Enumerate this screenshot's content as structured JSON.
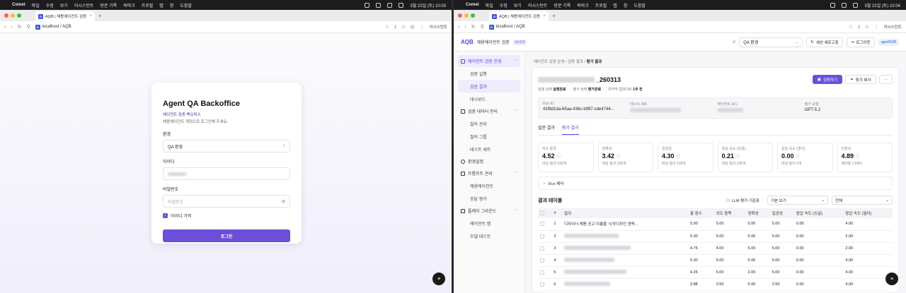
{
  "left": {
    "menubar": {
      "app": "Comet",
      "items": [
        "파일",
        "수정",
        "보기",
        "어시스턴트",
        "방문 기록",
        "북마크",
        "프로필",
        "탭",
        "창",
        "도움말"
      ],
      "clock": "3월 22일 (토) 10:03"
    },
    "tab": {
      "title": "AQB | 채용에이전트 검증"
    },
    "address": {
      "url": "localhost / AQB",
      "assistant": "어시스턴트"
    },
    "login": {
      "title": "Agent QA Backoffice",
      "subtitle": "에이전트 검증 백오피스",
      "hint": "채용에이전트 계정으로 로그인해 주세요.",
      "env_label": "환경",
      "env_value": "QA 환경",
      "id_label": "아이디",
      "pw_label": "비밀번호",
      "pw_placeholder": "비밀번호",
      "remember": "아이디 기억",
      "submit": "로그인"
    }
  },
  "right": {
    "menubar": {
      "app": "Comet",
      "items": [
        "파일",
        "수정",
        "보기",
        "어시스턴트",
        "방문 기록",
        "북마크",
        "프로필",
        "탭",
        "창",
        "도움말"
      ],
      "clock": "3월 22일 (토) 10:04"
    },
    "tab": {
      "title": "AQB | 채용에이전트 검증"
    },
    "address": {
      "url": "localhost / AQB",
      "assistant": "어시스턴트"
    },
    "header": {
      "logo": "AQB",
      "app_name": "채용에이전트 검증",
      "version": "v1.0.0",
      "env": "QA 환경",
      "refresh": "세션 새로고침",
      "logout": "로그아웃",
      "user": "ago0528"
    },
    "sidebar": {
      "groups": [
        {
          "label": "에이전트 검증 운영",
          "items": [
            "검증 실행",
            "검증 결과",
            "대시보드"
          ]
        },
        {
          "label": "검증 데이터 관리",
          "items": [
            "질의 관리",
            "질의 그룹",
            "테스트 세트"
          ]
        },
        {
          "label": "환경설정",
          "items": []
        },
        {
          "label": "프롬프트 관리",
          "items": [
            "채용에이전트",
            "응답 평가"
          ]
        },
        {
          "label": "플레이 그라운드",
          "items": [
            "에이전트 맵",
            "모델 테스트"
          ]
        }
      ]
    },
    "breadcrumb": [
      "에이전트 검증 운영",
      "검증 결과",
      "평가 결과"
    ],
    "run": {
      "title_suffix": "_260313",
      "run_button": "검증하기",
      "copy_link": "링크 복사",
      "more": "···",
      "exec_status_label": "실행 상태",
      "exec_status": "실행완료",
      "eval_status_label": "평가 상태",
      "eval_status": "평가완료",
      "updated_label": "마지막 업데이트",
      "updated": "1주 전",
      "info": [
        {
          "label": "Run ID",
          "value": "41f8d1da-65aa-436c-b997-cde4744..."
        },
        {
          "label": "테스트 세트",
          "value": ""
        },
        {
          "label": "에이전트 모드",
          "value": ""
        },
        {
          "label": "평가 모델",
          "value": "GPT-5.2"
        }
      ]
    },
    "tabs": [
      "질문 결과",
      "평가 결과"
    ],
    "metrics": [
      {
        "label": "의도 충족",
        "value": "4.52",
        "sub": "대상 질의 236개"
      },
      {
        "label": "정확성",
        "value": "3.42",
        "sub": "대상 질의 236개"
      },
      {
        "label": "일관성",
        "value": "4.30",
        "sub": "대상 질의 118개"
      },
      {
        "label": "응답 속도 (싱글)",
        "value": "0.21",
        "sub": "대상 질의 236개"
      },
      {
        "label": "응답 속도 (멀티)",
        "value": "0.00",
        "sub": "대상 질의 0개"
      },
      {
        "label": "안정성",
        "value": "4.89",
        "sub": "에러율 1.69%"
      }
    ],
    "run_meta_label": "Run 메타",
    "results": {
      "title": "결과 테이블",
      "llm_button": "LLM 평가 기준표",
      "view": "기본 보기",
      "filter": "전체",
      "columns": [
        "#",
        "질의",
        "총 점수",
        "의도 충족",
        "정확성",
        "일관성",
        "응답 속도 (싱글)",
        "응답 속도 (멀티)"
      ],
      "rows": [
        {
          "n": "1",
          "q": "디자이너 채용 공고 이름을 '시각디자인 경력...",
          "total": "5.00",
          "intent": "5.00",
          "acc": "5.00",
          "cons": "5.00",
          "single": "0.00",
          "multi": "4.00"
        },
        {
          "n": "2",
          "q": "",
          "total": "5.00",
          "intent": "5.00",
          "acc": "5.00",
          "cons": "5.00",
          "single": "0.00",
          "multi": "2.00"
        },
        {
          "n": "3",
          "q": "",
          "total": "4.75",
          "intent": "4.00",
          "acc": "5.00",
          "cons": "5.00",
          "single": "0.00",
          "multi": "2.00"
        },
        {
          "n": "4",
          "q": "",
          "total": "5.00",
          "intent": "5.00",
          "acc": "5.00",
          "cons": "5.00",
          "single": "0.00",
          "multi": "4.00"
        },
        {
          "n": "5",
          "q": "",
          "total": "4.25",
          "intent": "5.00",
          "acc": "2.00",
          "cons": "5.00",
          "single": "0.00",
          "multi": "4.00"
        },
        {
          "n": "6",
          "q": "",
          "total": "3.88",
          "intent": "3.50",
          "acc": "5.00",
          "cons": "2.50",
          "single": "0.00",
          "multi": "4.00"
        }
      ]
    }
  }
}
